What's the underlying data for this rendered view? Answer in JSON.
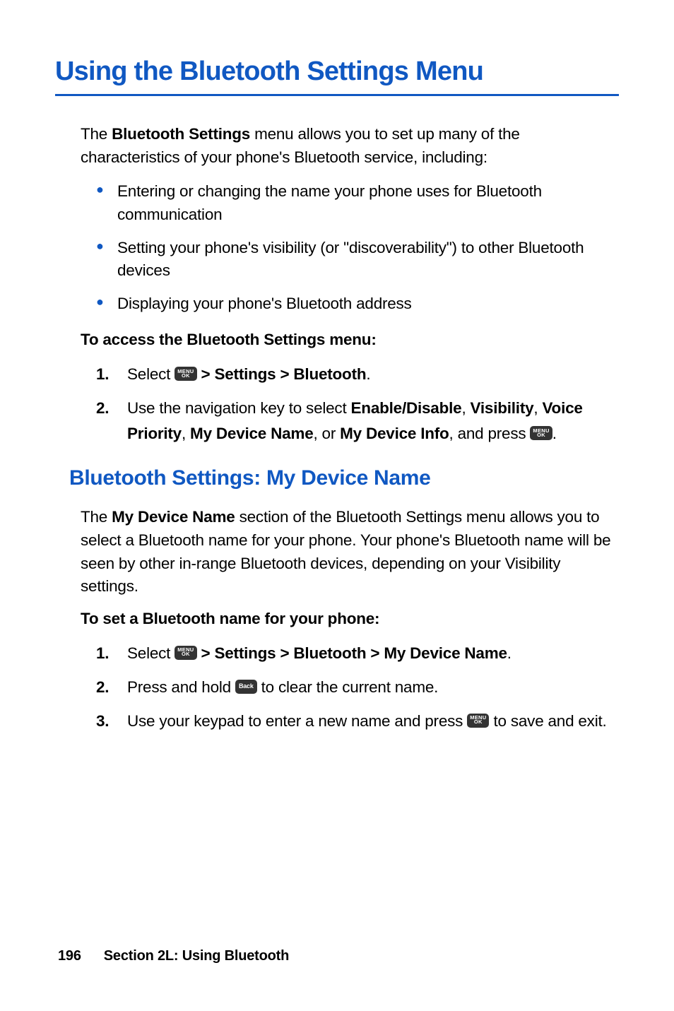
{
  "title": "Using the Bluetooth Settings Menu",
  "intro": {
    "prefix": "The ",
    "bold": "Bluetooth Settings",
    "suffix": " menu allows you to set up many of the characteristics of your phone's Bluetooth service, including:"
  },
  "bullets": [
    "Entering or changing the name your phone uses for Bluetooth communication",
    "Setting your phone's visibility (or \"discoverability\") to other Bluetooth devices",
    "Displaying your phone's Bluetooth address"
  ],
  "sub1": "To access the Bluetooth Settings menu:",
  "steps1": {
    "n1": "1.",
    "s1_pre": "Select ",
    "s1_post": " > Settings > Bluetooth",
    "s1_period": ".",
    "n2": "2.",
    "s2_pre": "Use the navigation key to select ",
    "s2_b1": "Enable/Disable",
    "s2_c1": ", ",
    "s2_b2": "Visibility",
    "s2_c2": ", ",
    "s2_b3": "Voice Priority",
    "s2_c3": ", ",
    "s2_b4": "My Device Name",
    "s2_c4": ", or ",
    "s2_b5": "My Device Info",
    "s2_c5": ", and press ",
    "s2_period": "."
  },
  "section2": "Bluetooth Settings: My Device Name",
  "para2": {
    "prefix": "The ",
    "bold": "My Device Name",
    "suffix": " section of the Bluetooth Settings menu allows you to select a Bluetooth name for your phone. Your phone's Bluetooth name will be seen by other in-range Bluetooth devices, depending on your Visibility settings."
  },
  "sub2": "To set a Bluetooth name for your phone:",
  "steps2": {
    "n1": "1.",
    "s1_pre": "Select ",
    "s1_post": " > Settings > Bluetooth > My Device Name",
    "s1_period": ".",
    "n2": "2.",
    "s2_pre": "Press and hold ",
    "s2_post": " to clear the current name.",
    "n3": "3.",
    "s3_pre": "Use your keypad to enter a new name and press ",
    "s3_post": " to save and exit."
  },
  "key_menu_top": "MENU",
  "key_menu_bot": "OK",
  "key_back": "Back",
  "footer": {
    "page": "196",
    "section": "Section 2L: Using Bluetooth"
  }
}
